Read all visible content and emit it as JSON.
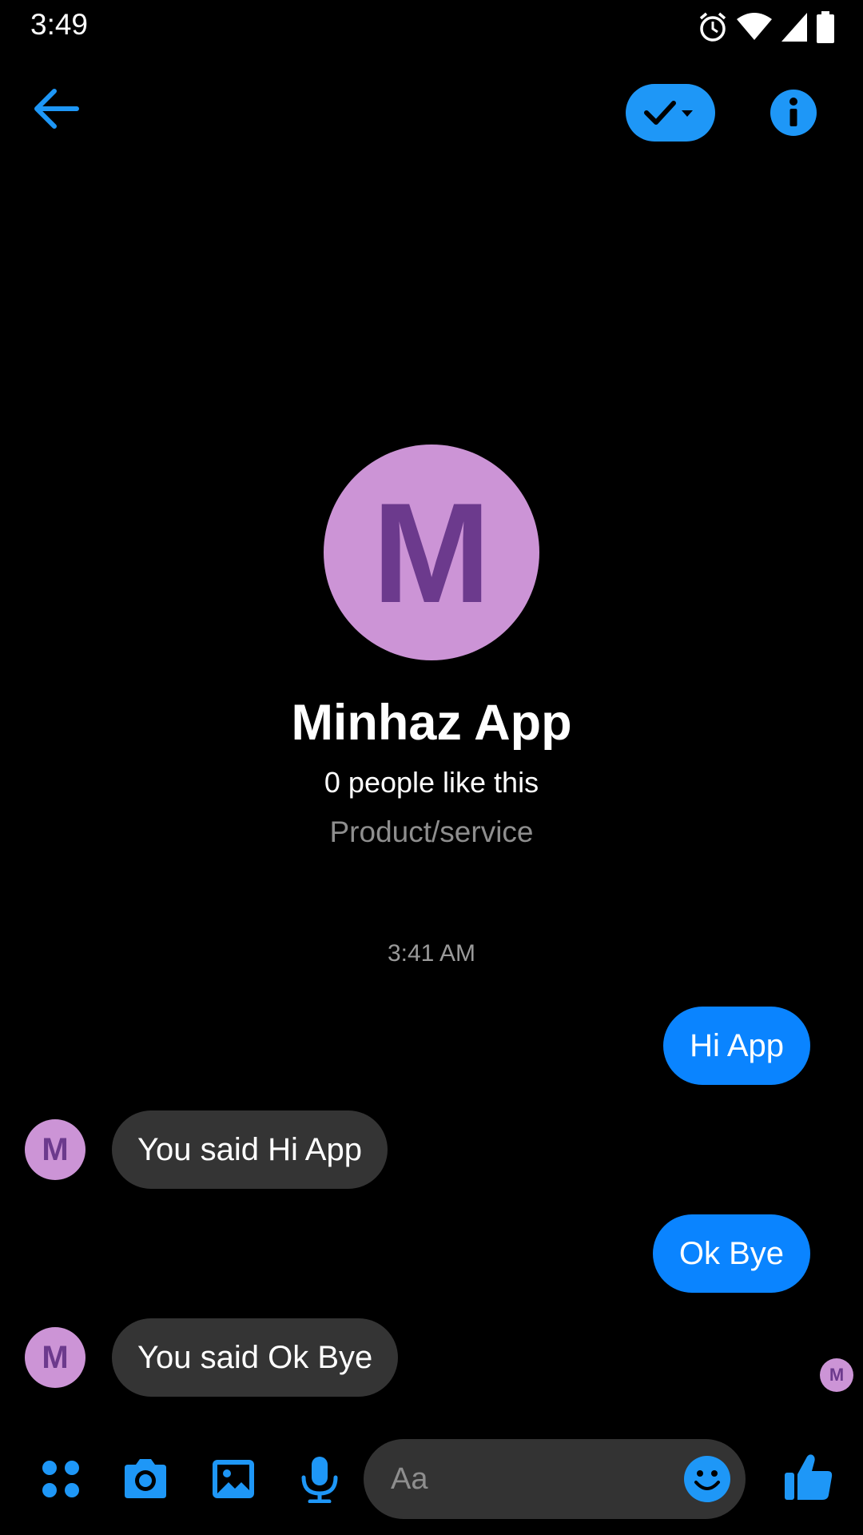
{
  "status_bar": {
    "time": "3:49",
    "icons": [
      "alarm-icon",
      "wifi-icon",
      "signal-icon",
      "battery-icon"
    ]
  },
  "header": {
    "back_icon": "arrow-left-icon",
    "status_icon": "check-dropdown-icon",
    "info_icon": "info-icon"
  },
  "profile": {
    "avatar_letter": "M",
    "name": "Minhaz App",
    "likes": "0 people like this",
    "category": "Product/service"
  },
  "conversation": {
    "timestamp": "3:41 AM",
    "messages": [
      {
        "direction": "outgoing",
        "text": "Hi App"
      },
      {
        "direction": "incoming",
        "avatar_letter": "M",
        "text": "You said Hi App"
      },
      {
        "direction": "outgoing",
        "text": "Ok Bye"
      },
      {
        "direction": "incoming",
        "avatar_letter": "M",
        "text": "You said Ok Bye"
      }
    ],
    "seen_avatar_letter": "M"
  },
  "composer": {
    "icons": [
      "apps-icon",
      "camera-icon",
      "gallery-icon",
      "microphone-icon",
      "emoji-icon",
      "thumbs-up-icon"
    ],
    "placeholder": "Aa"
  },
  "colors": {
    "accent": "#1e97f7",
    "outgoing_bubble": "#0a84ff",
    "incoming_bubble": "#343434",
    "avatar_bg": "#cc94d6",
    "avatar_text": "#6c3a8d"
  }
}
